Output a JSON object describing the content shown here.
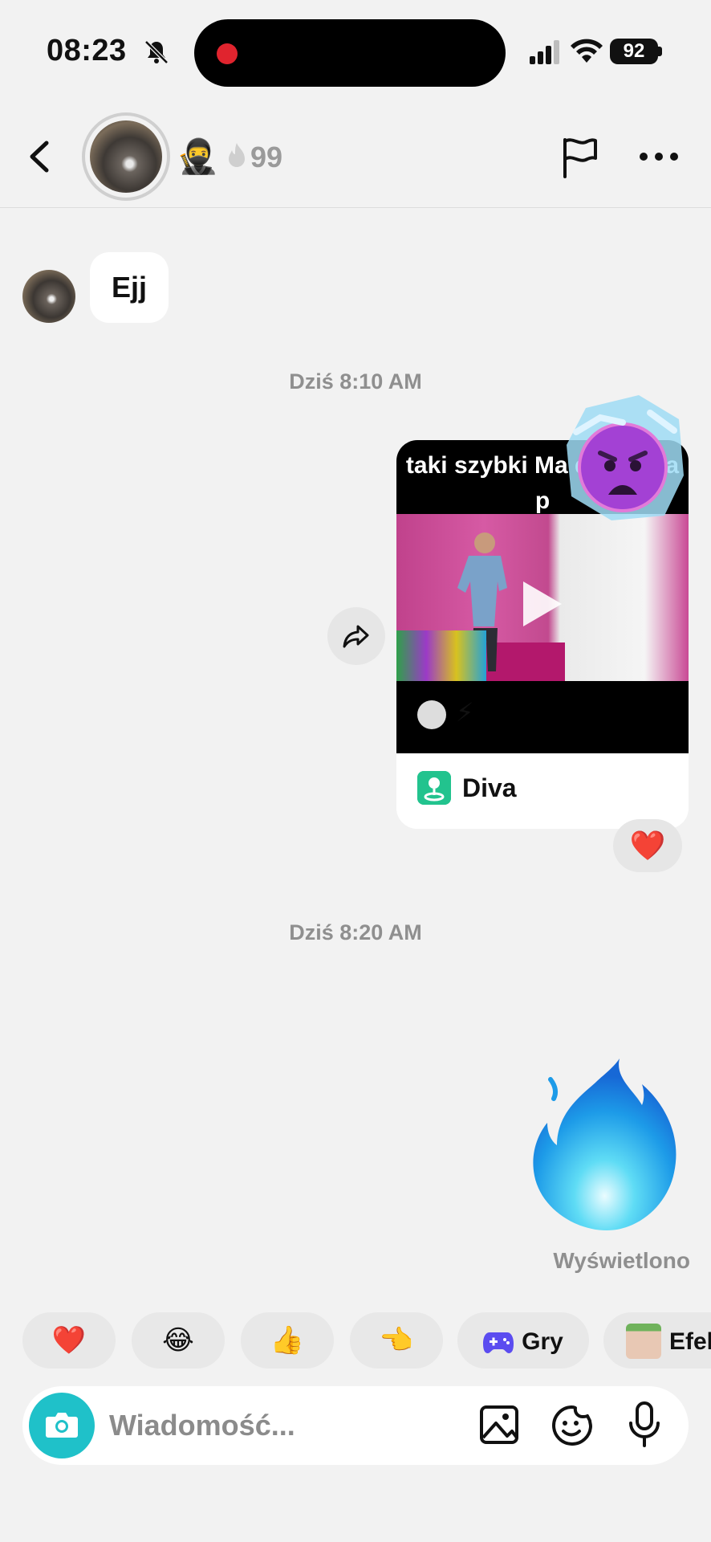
{
  "status_bar": {
    "time": "08:23",
    "battery": "92"
  },
  "header": {
    "ninja_emoji": "🥷",
    "streak_count": "99"
  },
  "messages": {
    "incoming_text": "Ejj",
    "timestamp_1": "Dziś 8:10 AM",
    "shared_video": {
      "caption": "taki szybki Ma dance na p",
      "bolt_emoji": "⚡",
      "link_label": "Diva"
    },
    "reaction_emoji": "❤️",
    "timestamp_2": "Dziś 8:20 AM",
    "seen_label": "Wyświetlono"
  },
  "quick_replies": [
    {
      "emoji": "❤️"
    },
    {
      "emoji": "😂"
    },
    {
      "emoji": "👍"
    },
    {
      "emoji": "👈"
    },
    {
      "label": "Gry"
    },
    {
      "label": "Efek"
    }
  ],
  "composer": {
    "placeholder": "Wiadomość..."
  },
  "colors": {
    "accent_teal": "#1fc1c9",
    "diva_green": "#22c38e",
    "reaction_red": "#e0242e"
  }
}
